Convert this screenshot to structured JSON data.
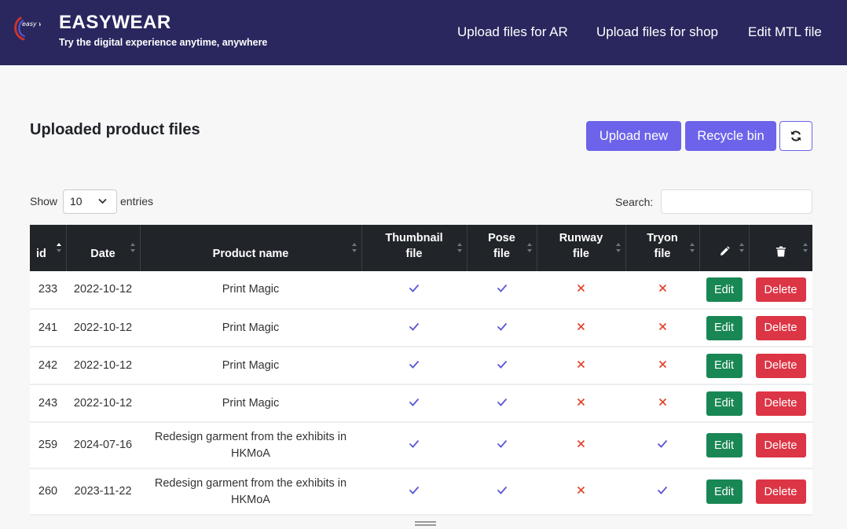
{
  "header": {
    "logo_text": "easy wear",
    "brand": "EASYWEAR",
    "tagline": "Try the digital experience anytime, anywhere",
    "nav": [
      "Upload files for AR",
      "Upload files for shop",
      "Edit MTL file"
    ]
  },
  "page": {
    "title": "Uploaded product files",
    "upload_new_label": "Upload new",
    "recycle_bin_label": "Recycle bin"
  },
  "controls": {
    "show_label": "Show",
    "entries_value": "10",
    "entries_label": "entries",
    "search_label": "Search:",
    "search_value": ""
  },
  "table": {
    "columns": [
      "id",
      "Date",
      "Product name",
      "Thumbnail file",
      "Pose file",
      "Runway file",
      "Tryon file",
      "edit-icon",
      "trash-icon"
    ],
    "edit_label": "Edit",
    "delete_label": "Delete",
    "rows": [
      {
        "id": "233",
        "date": "2022-10-12",
        "name": "Print Magic",
        "thumbnail": true,
        "pose": true,
        "runway": false,
        "tryon": false
      },
      {
        "id": "241",
        "date": "2022-10-12",
        "name": "Print Magic",
        "thumbnail": true,
        "pose": true,
        "runway": false,
        "tryon": false
      },
      {
        "id": "242",
        "date": "2022-10-12",
        "name": "Print Magic",
        "thumbnail": true,
        "pose": true,
        "runway": false,
        "tryon": false
      },
      {
        "id": "243",
        "date": "2022-10-12",
        "name": "Print Magic",
        "thumbnail": true,
        "pose": true,
        "runway": false,
        "tryon": false
      },
      {
        "id": "259",
        "date": "2024-07-16",
        "name": "Redesign garment from the exhibits in HKMoA",
        "thumbnail": true,
        "pose": true,
        "runway": false,
        "tryon": true
      },
      {
        "id": "260",
        "date": "2023-11-22",
        "name": "Redesign garment from the exhibits in HKMoA",
        "thumbnail": true,
        "pose": true,
        "runway": false,
        "tryon": true
      }
    ]
  },
  "colors": {
    "navbar": "#29275e",
    "accent": "#6c63ea",
    "check": "#5a57d6",
    "cross": "#e0482f",
    "edit": "#198754",
    "delete": "#dc3545"
  }
}
